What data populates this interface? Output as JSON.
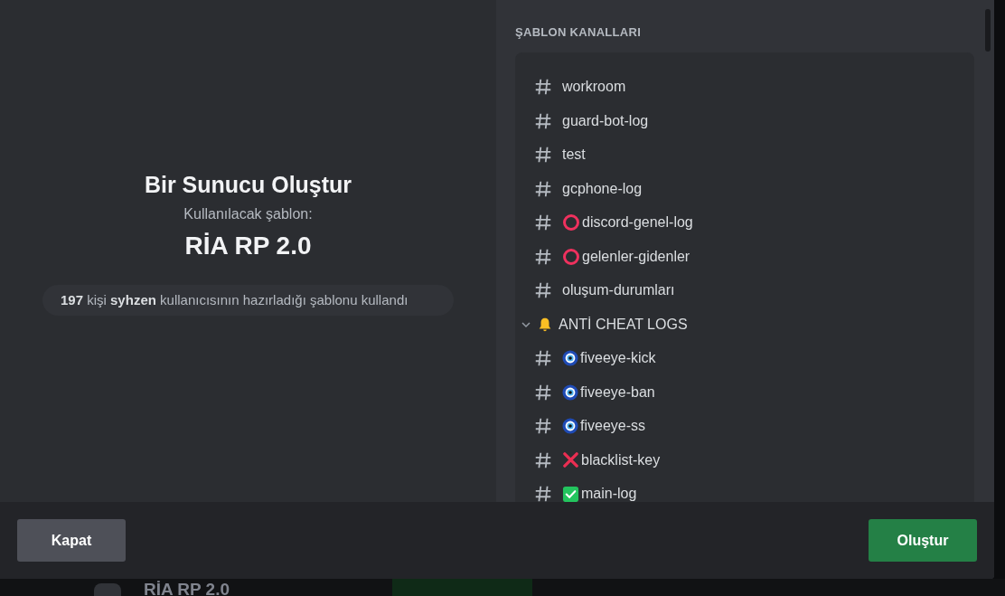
{
  "modal": {
    "title": "Bir Sunucu Oluştur",
    "subtitle": "Kullanılacak şablon:",
    "template_name": "RİA RP 2.0",
    "usage_note": "**197** kişi **syhzen** kullanıcısının hazırladığı şablonu kullandı",
    "channels_header": "ŞABLON KANALLARI",
    "channels": [
      {
        "kind": "channel",
        "name": "workroom"
      },
      {
        "kind": "channel",
        "name": "guard-bot-log"
      },
      {
        "kind": "channel",
        "name": "test"
      },
      {
        "kind": "channel",
        "name": "gcphone-log"
      },
      {
        "kind": "ring",
        "name": "discord-genel-log"
      },
      {
        "kind": "ring",
        "name": "gelenler-gidenler"
      },
      {
        "kind": "channel",
        "name": "oluşum-durumları"
      },
      {
        "kind": "category",
        "name": "ANTİ CHEAT LOGS"
      },
      {
        "kind": "eye",
        "name": "fiveeye-kick"
      },
      {
        "kind": "eye",
        "name": "fiveeye-ban"
      },
      {
        "kind": "eye",
        "name": "fiveeye-ss"
      },
      {
        "kind": "cross",
        "name": "blacklist-key"
      },
      {
        "kind": "check",
        "name": "main-log"
      }
    ],
    "buttons": [
      {
        "kind": "secondary",
        "label": "Kapat"
      },
      {
        "kind": "primary",
        "label": "Oluştur"
      }
    ]
  },
  "background": {
    "template_name": "RİA RP 2.0"
  }
}
